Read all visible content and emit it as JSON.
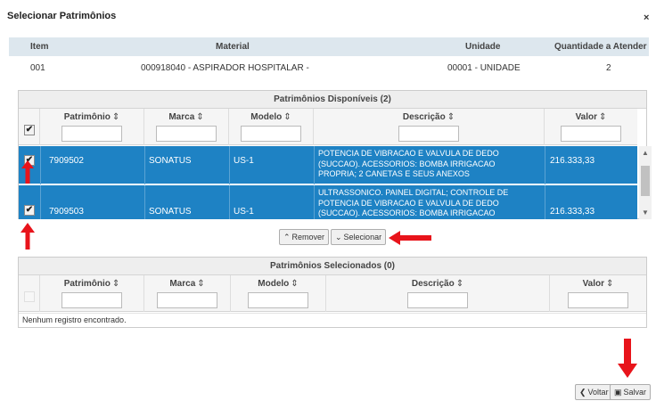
{
  "dialog": {
    "title": "Selecionar Patrimônios",
    "close_glyph": "×"
  },
  "summary": {
    "headers": {
      "item": "Item",
      "material": "Material",
      "unidade": "Unidade",
      "quantidade": "Quantidade a Atender"
    },
    "row": {
      "item": "001",
      "material": "000918040 - ASPIRADOR HOSPITALAR -",
      "unidade": "00001 - UNIDADE",
      "quantidade": "2"
    }
  },
  "available": {
    "caption": "Patrimônios Disponíveis (2)",
    "columns": {
      "patrimonio": "Patrimônio",
      "marca": "Marca",
      "modelo": "Modelo",
      "descricao": "Descrição",
      "valor": "Valor"
    },
    "sort_glyph": "⇕",
    "check_glyph": "✔",
    "rows": [
      {
        "checked": true,
        "patrimonio": "7909502",
        "marca": "SONATUS",
        "modelo": "US-1",
        "descricao": "POTENCIA DE VIBRACAO E VALVULA DE DEDO (SUCCAO). ACESSORIOS: BOMBA IRRIGACAO PROPRIA; 2 CANETAS E SEUS ANEXOS",
        "valor": "216.333,33"
      },
      {
        "checked": true,
        "patrimonio": "7909503",
        "marca": "SONATUS",
        "modelo": "US-1",
        "descricao": "ULTRASSONICO. PAINEL DIGITAL; CONTROLE DE POTENCIA DE VIBRACAO E VALVULA DE DEDO (SUCCAO). ACESSORIOS: BOMBA IRRIGACAO",
        "valor": "216.333,33"
      }
    ]
  },
  "actions": {
    "remove_label": "Remover",
    "select_label": "Selecionar"
  },
  "selected": {
    "caption": "Patrimônios Selecionados (0)",
    "columns": {
      "patrimonio": "Patrimônio",
      "marca": "Marca",
      "modelo": "Modelo",
      "descricao": "Descrição",
      "valor": "Valor"
    },
    "empty_message": "Nenhum registro encontrado."
  },
  "footer": {
    "back_label": "Voltar",
    "save_label": "Salvar"
  },
  "colors": {
    "accent": "#1e82c4",
    "arrow": "#e8141b",
    "header_bg": "#dde7ee"
  }
}
